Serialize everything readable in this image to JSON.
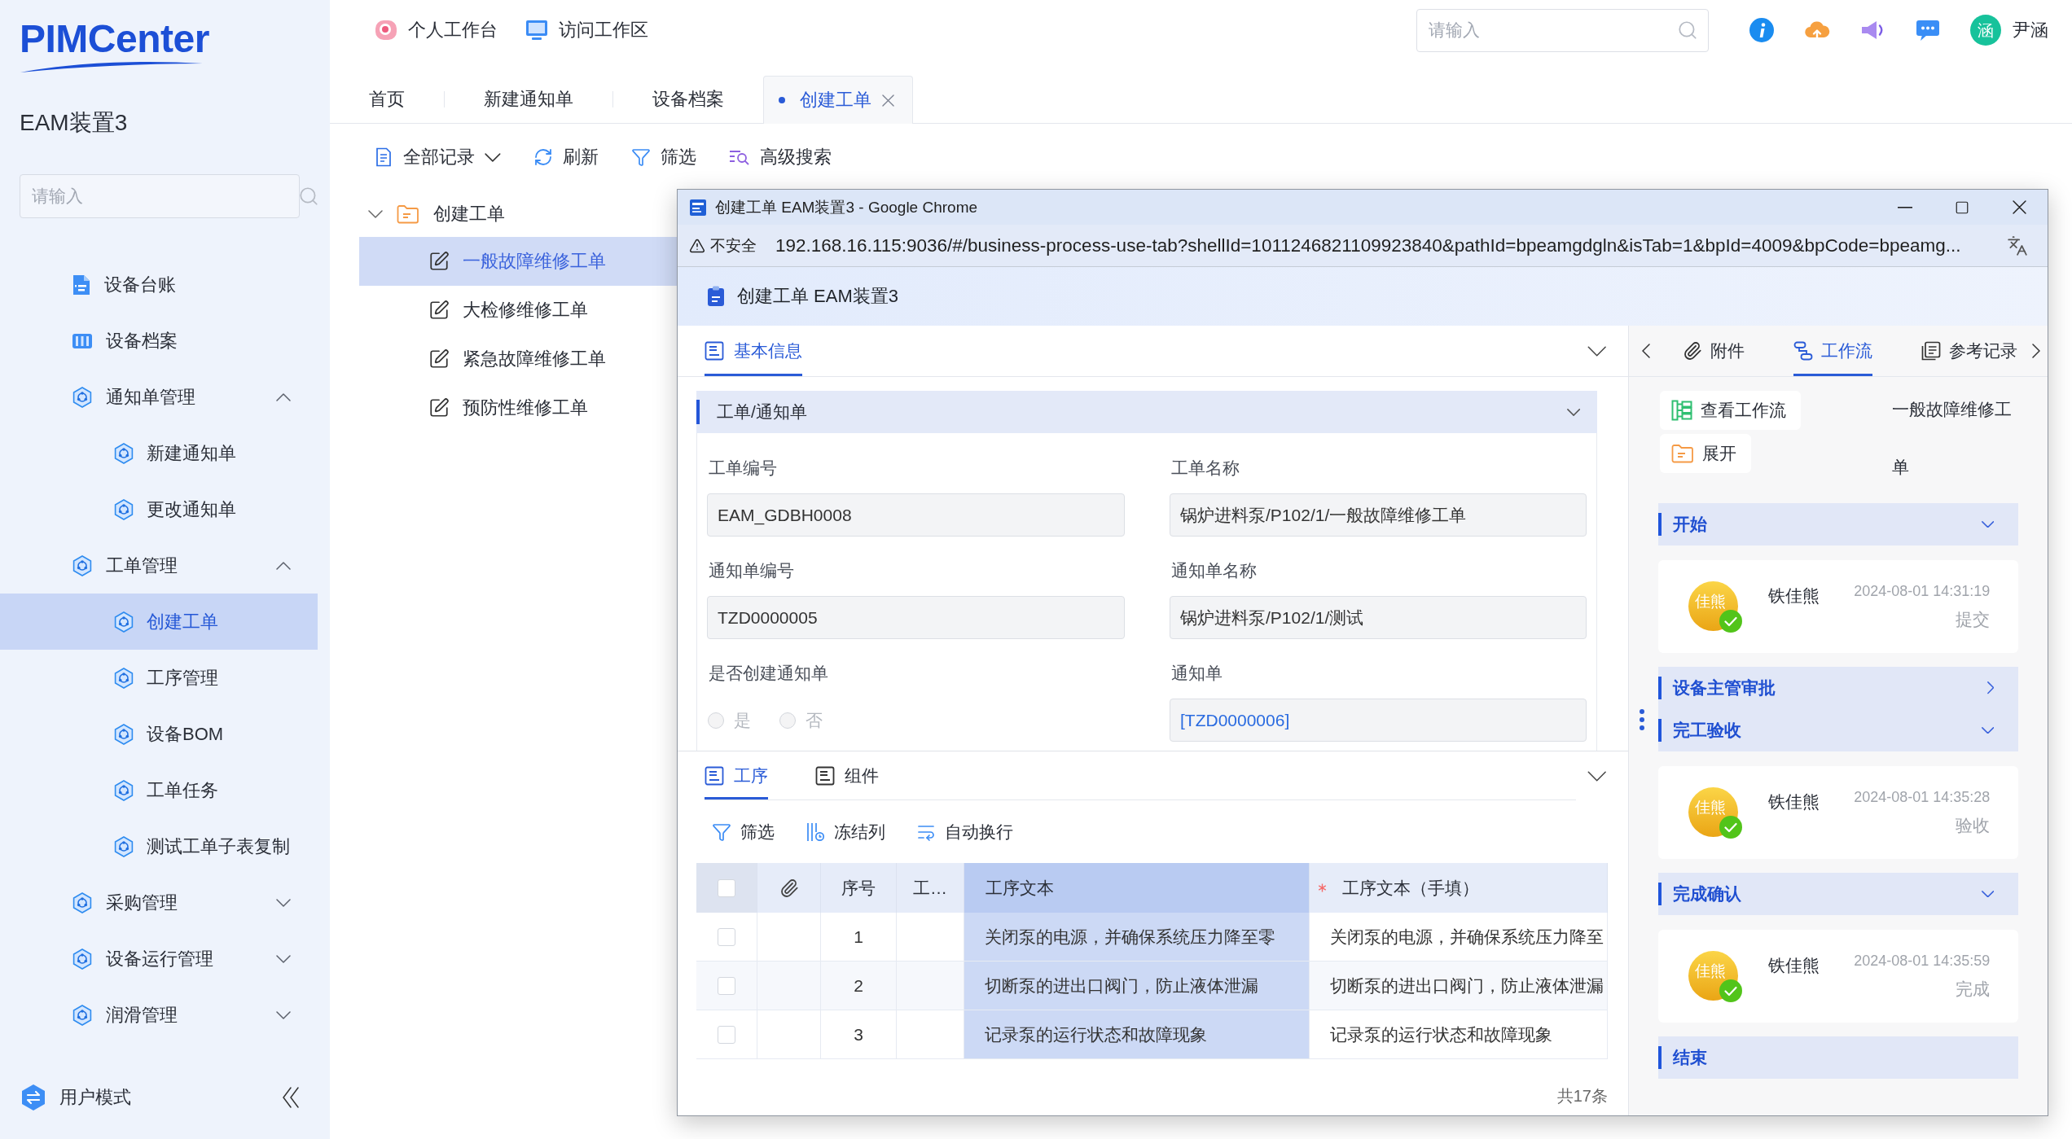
{
  "sidebar": {
    "logo": "PIMCenter",
    "title": "EAM装置3",
    "search": {
      "placeholder": "请输入"
    },
    "items": [
      {
        "kind": "page",
        "label": "设备台账",
        "selected": false
      },
      {
        "kind": "page",
        "label": "设备档案",
        "selected": false
      },
      {
        "kind": "group",
        "label": "通知单管理",
        "expanded": true,
        "children": [
          {
            "label": "新建通知单",
            "selected": false
          },
          {
            "label": "更改通知单",
            "selected": false
          }
        ]
      },
      {
        "kind": "group",
        "label": "工单管理",
        "expanded": true,
        "children": [
          {
            "label": "创建工单",
            "selected": true
          },
          {
            "label": "工序管理",
            "selected": false
          },
          {
            "label": "设备BOM",
            "selected": false
          },
          {
            "label": "工单任务",
            "selected": false
          },
          {
            "label": "测试工单子表复制",
            "selected": false
          }
        ]
      },
      {
        "kind": "group",
        "label": "采购管理",
        "expanded": false
      },
      {
        "kind": "group",
        "label": "设备运行管理",
        "expanded": false
      },
      {
        "kind": "group",
        "label": "润滑管理",
        "expanded": false
      }
    ],
    "footer": {
      "label": "用户模式"
    }
  },
  "header": {
    "links": [
      {
        "label": "个人工作台"
      },
      {
        "label": "访问工作区"
      }
    ],
    "search": {
      "placeholder": "请输入"
    },
    "user": {
      "avatar": "涵",
      "name": "尹涵"
    }
  },
  "tabs": [
    {
      "label": "首页",
      "selected": false
    },
    {
      "label": "新建通知单",
      "selected": false
    },
    {
      "label": "设备档案",
      "selected": false
    },
    {
      "label": "创建工单",
      "selected": true
    }
  ],
  "toolbar": [
    {
      "kind": "dropdown",
      "label": "全部记录"
    },
    {
      "kind": "button",
      "label": "刷新"
    },
    {
      "kind": "button",
      "label": "筛选"
    },
    {
      "kind": "button",
      "label": "高级搜索"
    }
  ],
  "tree": {
    "label": "创建工单",
    "expanded": true,
    "children": [
      {
        "label": "一般故障维修工单",
        "selected": true
      },
      {
        "label": "大检修维修工单",
        "selected": false
      },
      {
        "label": "紧急故障维修工单",
        "selected": false
      },
      {
        "label": "预防性维修工单",
        "selected": false
      }
    ]
  },
  "popup": {
    "title": "创建工单 EAM装置3 - Google Chrome",
    "security": "不安全",
    "url": "192.168.16.115:9036/#/business-process-use-tab?shellId=1011246821109923840&pathId=bpeamgdgln&isTab=1&bpId=4009&bpCode=bpeamg...",
    "heading": "创建工单 EAM装置3",
    "main_tabs": [
      {
        "label": "基本信息",
        "selected": true
      }
    ],
    "section": {
      "title": "工单/通知单",
      "expanded": true,
      "fields": [
        {
          "kind": "text",
          "label": "工单编号",
          "value": "EAM_GDBH0008"
        },
        {
          "kind": "text",
          "label": "工单名称",
          "value": "锅炉进料泵/P102/1/一般故障维修工单"
        },
        {
          "kind": "text",
          "label": "通知单编号",
          "value": "TZD0000005"
        },
        {
          "kind": "text",
          "label": "通知单名称",
          "value": "锅炉进料泵/P102/1/测试"
        },
        {
          "kind": "radio",
          "label": "是否创建通知单",
          "disabled": true,
          "options": [
            {
              "label": "是",
              "selected": false
            },
            {
              "label": "否",
              "selected": false
            }
          ]
        },
        {
          "kind": "link",
          "label": "通知单",
          "value": "[TZD0000006]"
        }
      ]
    },
    "detail_tabs": [
      {
        "label": "工序",
        "selected": true
      },
      {
        "label": "组件",
        "selected": false
      }
    ],
    "table_toolbar": [
      {
        "label": "筛选"
      },
      {
        "label": "冻结列"
      },
      {
        "label": "自动换行"
      }
    ],
    "table": {
      "columns": [
        {
          "kind": "checkbox",
          "checked": false,
          "selected": false,
          "required": false
        },
        {
          "kind": "attachment",
          "selected": false,
          "required": false
        },
        {
          "kind": "text",
          "label": "序号",
          "selected": false,
          "required": false
        },
        {
          "kind": "text",
          "label": "工…",
          "selected": false,
          "required": false
        },
        {
          "kind": "text",
          "label": "工序文本",
          "selected": true,
          "required": false
        },
        {
          "kind": "text",
          "label": "工序文本（手填）",
          "selected": false,
          "required": true
        }
      ],
      "rows": [
        {
          "checked": false,
          "cells": [
            "",
            "",
            "1",
            "",
            "关闭泵的电源，并确保系统压力降至零",
            "关闭泵的电源，并确保系统压力降至"
          ]
        },
        {
          "checked": false,
          "cells": [
            "",
            "",
            "2",
            "",
            "切断泵的进出口阀门，防止液体泄漏",
            "切断泵的进出口阀门，防止液体泄漏"
          ]
        },
        {
          "checked": false,
          "cells": [
            "",
            "",
            "3",
            "",
            "记录泵的运行状态和故障现象",
            "记录泵的运行状态和故障现象"
          ]
        }
      ],
      "total": "共17条"
    },
    "side_tabs": [
      {
        "label": "附件",
        "selected": false
      },
      {
        "label": "工作流",
        "selected": true
      },
      {
        "label": "参考记录",
        "selected": false
      }
    ],
    "workflow": {
      "actions": [
        {
          "label": "查看工作流"
        },
        {
          "label": "展开"
        }
      ],
      "title": "一般故障维修工单",
      "steps": [
        {
          "name": "开始",
          "expanded": true,
          "records": [
            {
              "avatar": "佳熊",
              "user": "铁佳熊",
              "time": "2024-08-01 14:31:19",
              "action": "提交",
              "approved": true
            }
          ]
        },
        {
          "name": "设备主管审批",
          "expanded": false
        },
        {
          "name": "完工验收",
          "expanded": true,
          "records": [
            {
              "avatar": "佳熊",
              "user": "铁佳熊",
              "time": "2024-08-01 14:35:28",
              "action": "验收",
              "approved": true
            }
          ]
        },
        {
          "name": "完成确认",
          "expanded": true,
          "records": [
            {
              "avatar": "佳熊",
              "user": "铁佳熊",
              "time": "2024-08-01 14:35:59",
              "action": "完成",
              "approved": true
            }
          ]
        }
      ],
      "end": "结束"
    }
  }
}
